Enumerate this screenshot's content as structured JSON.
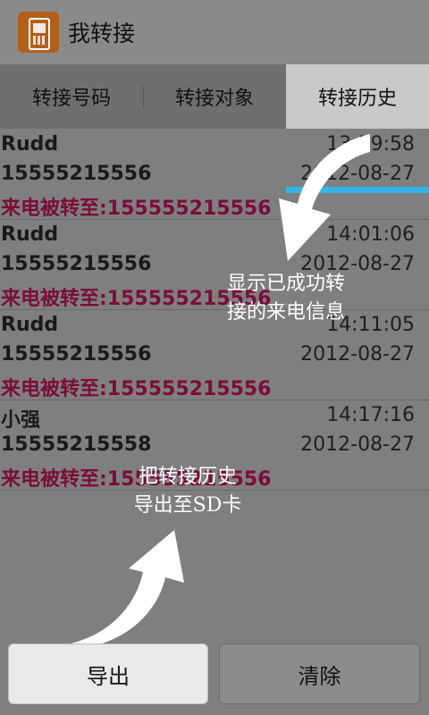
{
  "app": {
    "title": "我转接",
    "icon": "phone-app-icon"
  },
  "tabs": [
    {
      "label": "转接号码",
      "selected": false
    },
    {
      "label": "转接对象",
      "selected": false
    },
    {
      "label": "转接历史",
      "selected": true
    }
  ],
  "accent": "#33b5e5",
  "history": [
    {
      "name": "Rudd",
      "time": "13:59:58",
      "number": "15555215556",
      "date": "2012-08-27",
      "forward": "来电被转至:155555215556"
    },
    {
      "name": "Rudd",
      "time": "14:01:06",
      "number": "15555215556",
      "date": "2012-08-27",
      "forward": "来电被转至:155555215556"
    },
    {
      "name": "Rudd",
      "time": "14:11:05",
      "number": "15555215556",
      "date": "2012-08-27",
      "forward": "来电被转至:155555215556"
    },
    {
      "name": "小强",
      "time": "14:17:16",
      "number": "15555215558",
      "date": "2012-08-27",
      "forward": "来电被转至:155555215556"
    }
  ],
  "overlays": {
    "hint_top": {
      "line1": "显示已成功转",
      "line2": "接的来电信息"
    },
    "hint_bottom": {
      "line1": "把转接历史",
      "line2": "导出至SD卡"
    }
  },
  "buttons": {
    "export": "导出",
    "clear": "清除"
  }
}
